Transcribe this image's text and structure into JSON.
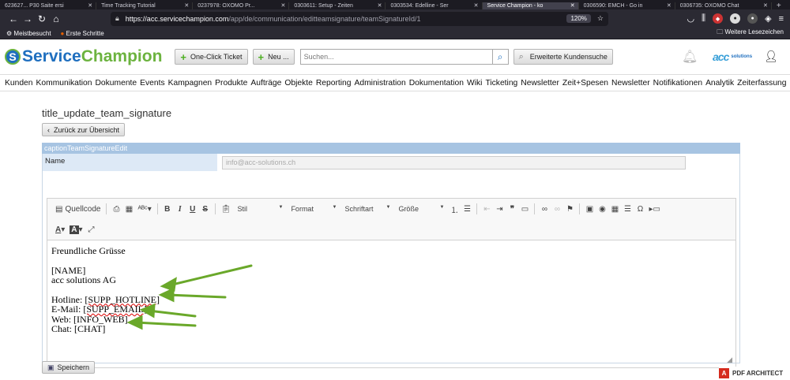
{
  "browser": {
    "tabs": [
      {
        "label": "623627... P30 Saite ersi",
        "active": false
      },
      {
        "label": "Time Tracking Tutorial",
        "active": false
      },
      {
        "label": "0237978: OXOMO Pr...",
        "active": false
      },
      {
        "label": "0303611: Setup - Zeiten",
        "active": false
      },
      {
        "label": "0303534: Edelline - Ser",
        "active": false
      },
      {
        "label": "Service Champion - ko",
        "active": true
      },
      {
        "label": "0306590: EMCH - Go in",
        "active": false
      },
      {
        "label": "0306735: OXOMO Chat",
        "active": false
      }
    ],
    "url_host": "https://acc.servicechampion.com",
    "url_path": "/app/de/communication/editteamsignature/teamSignatureId/1",
    "zoom": "120%",
    "bookmarks": {
      "left1": "Meistbesucht",
      "left2": "Erste Schritte",
      "right": "Weitere Lesezeichen"
    }
  },
  "header": {
    "logo_part1": "Service",
    "logo_part2": "Champion",
    "one_click": "One-Click Ticket",
    "new": "Neu ...",
    "search_placeholder": "Suchen...",
    "advanced_search": "Erweiterte Kundensuche",
    "brand_logo": "acc",
    "brand_suffix": "solutions"
  },
  "nav": [
    "Kunden",
    "Kommunikation",
    "Dokumente",
    "Events",
    "Kampagnen",
    "Produkte",
    "Aufträge",
    "Objekte",
    "Reporting",
    "Administration",
    "Dokumentation",
    "Wiki",
    "Ticketing",
    "Newsletter",
    "Zeit+Spesen",
    "Newsletter",
    "Notifikationen",
    "Analytik",
    "Zeiterfassung"
  ],
  "page": {
    "title": "title_update_team_signature",
    "back": "Zurück zur Übersicht",
    "card_title": "captionTeamSignatureEdit",
    "name_label": "Name",
    "name_value": "info@acc-solutions.ch",
    "save": "Speichern"
  },
  "toolbar": {
    "source": "Quellcode",
    "style": "Stil",
    "format": "Format",
    "font": "Schriftart",
    "size": "Größe"
  },
  "editor": {
    "greeting": "Freundliche Grüsse",
    "name_placeholder": "[NAME]",
    "company": "acc solutions AG",
    "hotline_label": "Hotline:",
    "hotline_value": "[SUPP_HOTLINE]",
    "email_label": "E-Mail:",
    "email_value": "[SUPP_EMAIL]",
    "web": "Web: [INFO_WEB]",
    "chat": "Chat: [CHAT]"
  },
  "footer_badge": "PDF ARCHITECT",
  "colors": {
    "brand_blue": "#1f6fbf",
    "brand_green": "#6cb33f",
    "arrow_green": "#6aa82a",
    "card_header": "#a7c4e2"
  }
}
